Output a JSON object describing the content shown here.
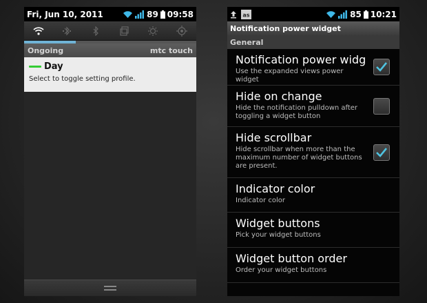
{
  "left": {
    "status": {
      "date": "Fri, Jun 10, 2011",
      "battery": "89",
      "time": "09:58"
    },
    "power_widget": {
      "buttons": [
        "wifi-icon",
        "bluetooth-data-icon",
        "bluetooth-icon",
        "sync-icon",
        "brightness-icon",
        "gps-icon"
      ]
    },
    "ongoing": {
      "header": "Ongoing",
      "source": "mtc touch"
    },
    "notification": {
      "title": "Day",
      "text": "Select to toggle setting profile.",
      "indicator_color": "#33cc33"
    }
  },
  "right": {
    "status": {
      "battery": "85",
      "time": "10:21"
    },
    "app_title": "Notification power widget",
    "section": "General",
    "prefs": [
      {
        "title": "Notification power widge",
        "summary": "Use the expanded views power widget",
        "checkbox": true,
        "checked": true
      },
      {
        "title": "Hide on change",
        "summary": "Hide the notification pulldown after toggling a widget button",
        "checkbox": true,
        "checked": false
      },
      {
        "title": "Hide scrollbar",
        "summary": "Hide scrollbar when more than the maximum number of widget buttons are present.",
        "checkbox": true,
        "checked": true
      },
      {
        "title": "Indicator color",
        "summary": "Indicator color",
        "checkbox": false
      },
      {
        "title": "Widget buttons",
        "summary": "Pick your widget buttons",
        "checkbox": false
      },
      {
        "title": "Widget button order",
        "summary": "Order your widget buttons",
        "checkbox": false
      }
    ]
  },
  "colors": {
    "check": "#4fc3e0",
    "wifi": "#3fb8e8",
    "indicator": "#6fb3d6"
  }
}
